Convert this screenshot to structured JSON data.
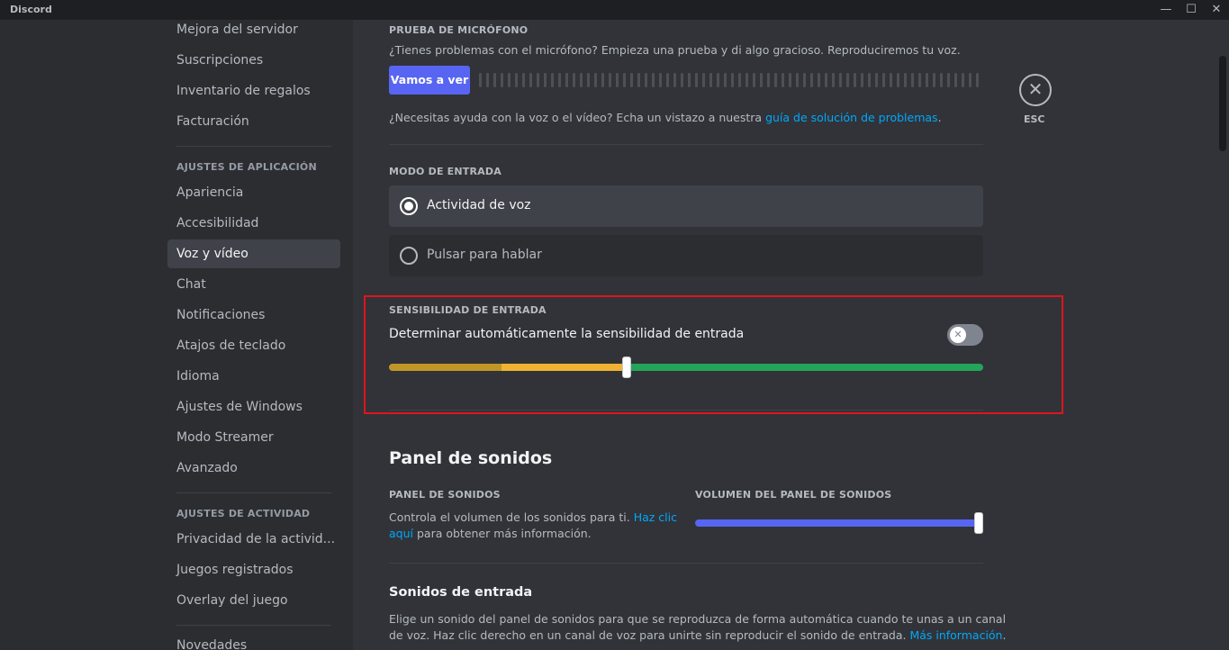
{
  "window": {
    "title": "Discord",
    "controls": {
      "minimize": "—",
      "maximize": "☐",
      "close": "✕"
    }
  },
  "sidebar": {
    "items_top": [
      "Mejora del servidor",
      "Suscripciones",
      "Inventario de regalos",
      "Facturación"
    ],
    "app_header": "AJUSTES DE APLICACIÓN",
    "app_items": [
      "Apariencia",
      "Accesibilidad",
      "Voz y vídeo",
      "Chat",
      "Notificaciones",
      "Atajos de teclado",
      "Idioma",
      "Ajustes de Windows",
      "Modo Streamer",
      "Avanzado"
    ],
    "selected": "Voz y vídeo",
    "activity_header": "AJUSTES DE ACTIVIDAD",
    "activity_items": [
      "Privacidad de la activid...",
      "Juegos registrados",
      "Overlay del juego"
    ],
    "news_item": "Novedades"
  },
  "mic_test": {
    "header": "PRUEBA DE MICRÓFONO",
    "description": "¿Tienes problemas con el micrófono? Empieza una prueba y di algo gracioso. Reproduciremos tu voz.",
    "button": "Vamos a ver",
    "help_prefix": "¿Necesitas ayuda con la voz o el vídeo? Echa un vistazo a nuestra ",
    "help_link": "guía de solución de problemas",
    "help_suffix": "."
  },
  "close": {
    "icon": "close-icon",
    "label": "ESC"
  },
  "input_mode": {
    "header": "MODO DE ENTRADA",
    "options": [
      "Actividad de voz",
      "Pulsar para hablar"
    ],
    "selected": "Actividad de voz"
  },
  "sensitivity": {
    "header": "SENSIBILIDAD DE ENTRADA",
    "auto_label": "Determinar automáticamente la sensibilidad de entrada",
    "auto_enabled": false,
    "toggle_icon": "✕",
    "level": 0.4,
    "mic_level": 0.19,
    "colors": {
      "dark": "#c09627",
      "yellow": "#f0b232",
      "green": "#23a55a"
    }
  },
  "soundboard": {
    "title": "Panel de sonidos",
    "panel_header": "PANEL DE SONIDOS",
    "panel_desc_1": "Controla el volumen de los sonidos para ti. ",
    "panel_link_1": "Haz clic",
    "panel_link_2": "aquí",
    "panel_desc_2": " para obtener más información.",
    "volume_header": "VOLUMEN DEL PANEL DE SONIDOS",
    "volume": 1.0,
    "entry_title": "Sonidos de entrada",
    "entry_desc_1": "Elige un sonido del panel de sonidos para que se reproduzca de forma automática cuando te unas a un canal",
    "entry_desc_2": "de voz. Haz clic derecho en un canal de voz para unirte sin reproducir el sonido de entrada. ",
    "entry_link": "Más información",
    "entry_suffix": "."
  },
  "accent": "#5865f2"
}
